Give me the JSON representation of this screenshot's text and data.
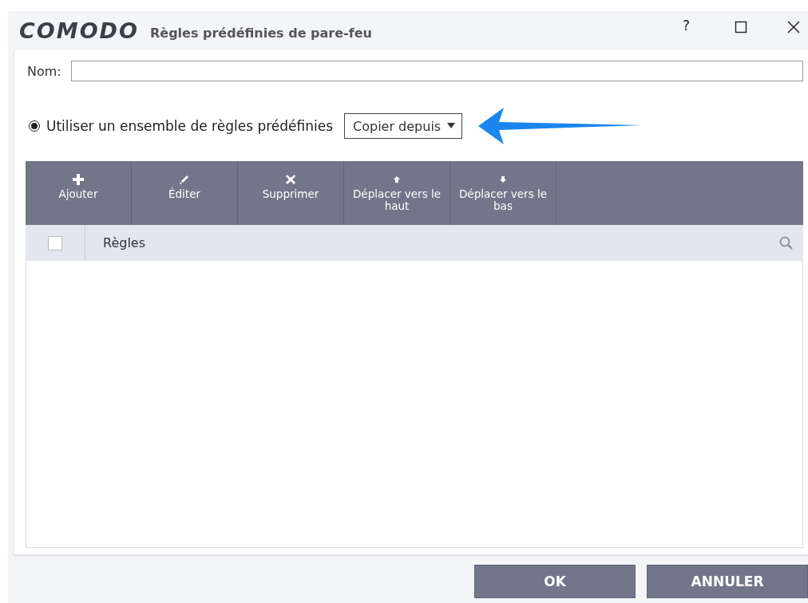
{
  "window": {
    "logo": "COMODO",
    "title": "Règles prédéfinies de pare-feu",
    "help": "?"
  },
  "name_field": {
    "label": "Nom:"
  },
  "ruleset": {
    "label": "Utiliser un ensemble de règles prédéfinies",
    "selected": true,
    "dropdown": "Copier depuis"
  },
  "toolbar": [
    {
      "kind": "add",
      "label": "Ajouter"
    },
    {
      "kind": "edit",
      "label": "Éditer"
    },
    {
      "kind": "delete",
      "label": "Supprimer"
    },
    {
      "kind": "up",
      "label": "Déplacer vers le haut"
    },
    {
      "kind": "down",
      "label": "Déplacer vers le bas"
    }
  ],
  "table": {
    "select_all_checked": false,
    "columns": [
      "Règles"
    ]
  },
  "buttons": [
    "OK",
    "ANNULER"
  ]
}
